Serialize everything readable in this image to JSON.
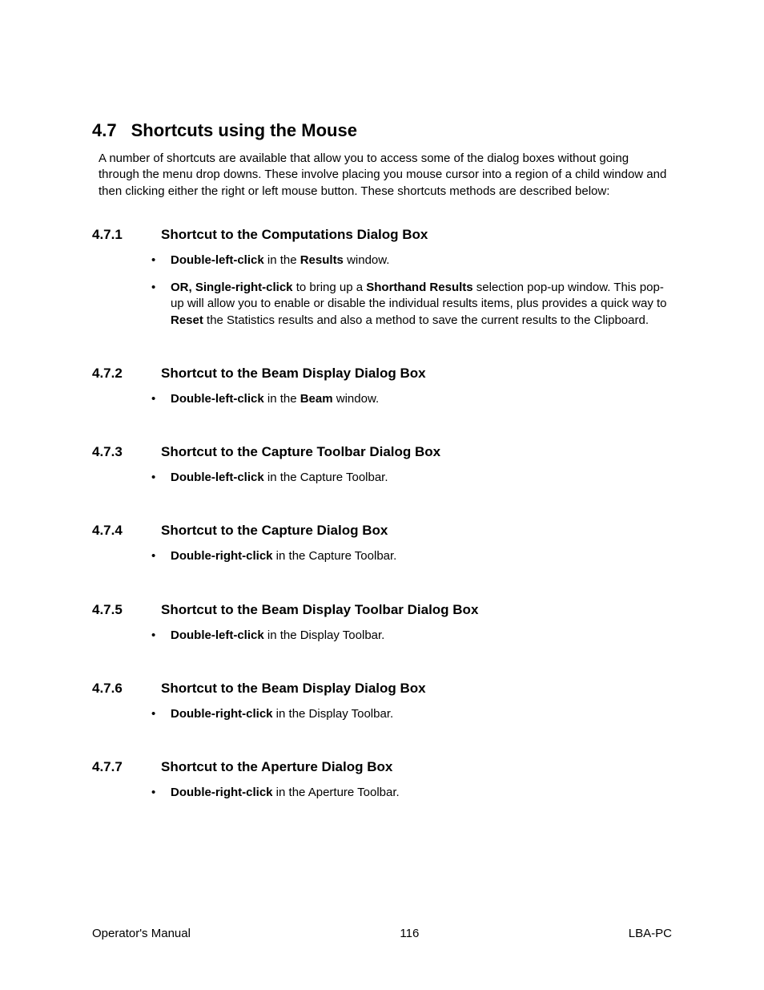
{
  "heading": {
    "number": "4.7",
    "title": "Shortcuts using the Mouse"
  },
  "intro": "A number of shortcuts are available that allow you to access some of the dialog boxes without going through the menu drop downs.  These involve placing you mouse cursor into a region of a child window and then clicking either the right or left mouse button.  These shortcuts methods are described below:",
  "sections": [
    {
      "number": "4.7.1",
      "title": "Shortcut to the Computations Dialog Box",
      "items": [
        {
          "runs": [
            {
              "t": "Double-left-click",
              "b": true
            },
            {
              "t": " in the "
            },
            {
              "t": "Results",
              "b": true
            },
            {
              "t": " window."
            }
          ]
        },
        {
          "runs": [
            {
              "t": "OR, Single-right-click",
              "b": true
            },
            {
              "t": " to bring up a "
            },
            {
              "t": "Shorthand Results",
              "b": true
            },
            {
              "t": " selection pop-up window.  This pop-up will allow you to enable or disable the individual results items, plus provides a quick way to "
            },
            {
              "t": "Reset",
              "b": true
            },
            {
              "t": " the Statistics results and also a method to save the current results to the Clipboard."
            }
          ]
        }
      ]
    },
    {
      "number": "4.7.2",
      "title": "Shortcut to the Beam Display Dialog Box",
      "items": [
        {
          "runs": [
            {
              "t": "Double-left-click",
              "b": true
            },
            {
              "t": " in the "
            },
            {
              "t": "Beam",
              "b": true
            },
            {
              "t": " window."
            }
          ]
        }
      ]
    },
    {
      "number": "4.7.3",
      "title": "Shortcut to the Capture Toolbar Dialog Box",
      "items": [
        {
          "runs": [
            {
              "t": "Double-left-click",
              "b": true
            },
            {
              "t": " in the Capture Toolbar."
            }
          ]
        }
      ]
    },
    {
      "number": "4.7.4",
      "title": "Shortcut to the Capture Dialog Box",
      "items": [
        {
          "runs": [
            {
              "t": "Double-right-click",
              "b": true
            },
            {
              "t": " in the Capture Toolbar."
            }
          ]
        }
      ]
    },
    {
      "number": "4.7.5",
      "title": "Shortcut to the Beam Display Toolbar Dialog Box",
      "items": [
        {
          "runs": [
            {
              "t": "Double-left-click",
              "b": true
            },
            {
              "t": " in the Display Toolbar."
            }
          ]
        }
      ]
    },
    {
      "number": "4.7.6",
      "title": "Shortcut to the Beam Display Dialog Box",
      "items": [
        {
          "runs": [
            {
              "t": "Double-right-click",
              "b": true
            },
            {
              "t": " in the Display Toolbar."
            }
          ]
        }
      ]
    },
    {
      "number": "4.7.7",
      "title": "Shortcut to the Aperture Dialog Box",
      "items": [
        {
          "runs": [
            {
              "t": "Double-right-click",
              "b": true
            },
            {
              "t": " in the Aperture Toolbar."
            }
          ]
        }
      ]
    }
  ],
  "footer": {
    "left": "Operator's Manual",
    "center": "116",
    "right": "LBA-PC"
  }
}
